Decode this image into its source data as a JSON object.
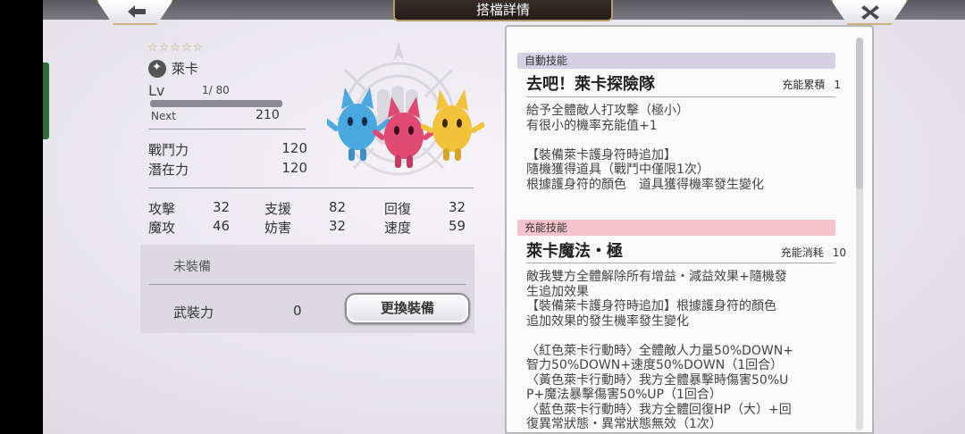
{
  "header": {
    "title": "搭檔詳情"
  },
  "character": {
    "stars": "☆☆☆☆☆",
    "name": "萊卡",
    "level_label": "Lv",
    "level_value": "1/ 80",
    "next_label": "Next",
    "next_value": "210",
    "power_label": "戰鬥力",
    "power_value": "120",
    "potential_label": "潛在力",
    "potential_value": "120"
  },
  "stats": [
    {
      "label": "攻擊",
      "value": "32"
    },
    {
      "label": "支援",
      "value": "82"
    },
    {
      "label": "回復",
      "value": "32"
    },
    {
      "label": "魔攻",
      "value": "46"
    },
    {
      "label": "妨害",
      "value": "32"
    },
    {
      "label": "速度",
      "value": "59"
    }
  ],
  "equipment": {
    "none_text": "未裝備",
    "armament_label": "武裝力",
    "armament_value": "0",
    "change_button": "更換裝備"
  },
  "skills": {
    "auto": {
      "tag": "自動技能",
      "name": "去吧！萊卡探險隊",
      "meta_label": "充能累積",
      "meta_value": "1",
      "description": "給予全體敵人打攻擊（極小）\n有很小的機率充能值+1\n\n【裝備萊卡護身符時追加】\n隨機獲得道具（戰鬥中僅限1次）\n根據護身符的顏色　道具獲得機率發生變化"
    },
    "charge": {
      "tag": "充能技能",
      "name": "萊卡魔法・極",
      "meta_label": "充能消耗",
      "meta_value": "10",
      "description": "敵我雙方全體解除所有增益・減益效果+隨機發\n生追加效果\n【裝備萊卡護身符時追加】根據護身符的顏色\n追加效果的發生機率發生變化\n\n〈紅色萊卡行動時〉全體敵人力量50%DOWN+\n智力50%DOWN+速度50%DOWN（1回合）\n〈黃色萊卡行動時〉我方全體暴擊時傷害50%U\nP+魔法暴擊傷害50%UP（1回合）\n〈藍色萊卡行動時〉我方全體回復HP（大）+回\n復異常狀態・異常狀態無效（1次）"
    }
  },
  "colors": {
    "auto_tag": "#d5d0e4",
    "charge_tag": "#f6c4cc",
    "gold": "#c9a45a"
  },
  "icons": {
    "back": "back-arrow-icon",
    "close": "close-icon"
  }
}
